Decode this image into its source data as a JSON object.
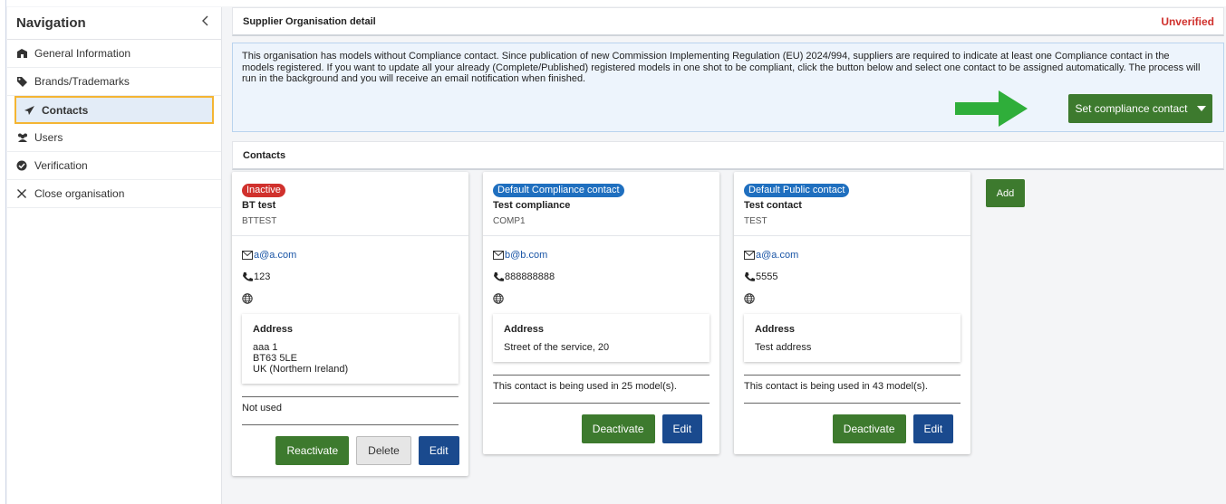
{
  "sidebar": {
    "title": "Navigation",
    "items": [
      {
        "label": "General Information",
        "icon": "building-icon"
      },
      {
        "label": "Brands/Trademarks",
        "icon": "tag-icon"
      },
      {
        "label": "Contacts",
        "icon": "paper-plane-icon",
        "active": true
      },
      {
        "label": "Users",
        "icon": "users-icon"
      },
      {
        "label": "Verification",
        "icon": "check-circle-icon"
      },
      {
        "label": "Close organisation",
        "icon": "close-icon"
      }
    ]
  },
  "header": {
    "title": "Supplier Organisation detail",
    "status": "Unverified"
  },
  "alert": {
    "text": "This organisation has models without Compliance contact. Since publication of new Commission Implementing Regulation (EU) 2024/994, suppliers are required to indicate at least one Compliance contact in the models registered. If you want to update all your already (Complete/Published) registered models in one shot to be compliant, click the button below and select one contact to be assigned automatically. The process will run in the background and you will receive an email notification when finished.",
    "button_label": "Set compliance contact"
  },
  "contacts_section": {
    "title": "Contacts",
    "add_label": "Add"
  },
  "contacts": [
    {
      "badge": "Inactive",
      "name": "BT test",
      "code": "BTTEST",
      "email": "a@a.com",
      "phone": "123",
      "address_label": "Address",
      "address_lines": [
        "aaa 1",
        "BT63 5LE",
        "UK (Northern Ireland)"
      ],
      "usage": "Not used",
      "buttons": [
        "Reactivate",
        "Delete",
        "Edit"
      ]
    },
    {
      "badge": "Default Compliance contact",
      "name": "Test compliance",
      "code": "COMP1",
      "email": "b@b.com",
      "phone": "888888888",
      "address_label": "Address",
      "address_lines": [
        "Street of the service, 20"
      ],
      "usage": "This contact is being used in 25 model(s).",
      "buttons": [
        "Deactivate",
        "Edit"
      ]
    },
    {
      "badge": "Default Public contact",
      "name": "Test contact",
      "code": "TEST",
      "email": "a@a.com",
      "phone": "5555",
      "address_label": "Address",
      "address_lines": [
        "Test address"
      ],
      "usage": "This contact is being used in 43 model(s).",
      "buttons": [
        "Deactivate",
        "Edit"
      ]
    }
  ],
  "colors": {
    "primary_green": "#3d7a2e",
    "primary_blue": "#1a4a8e",
    "badge_blue": "#1f6fbf",
    "badge_red": "#d0312d",
    "active_border": "#f4b533",
    "arrow_green": "#2fae3a"
  }
}
